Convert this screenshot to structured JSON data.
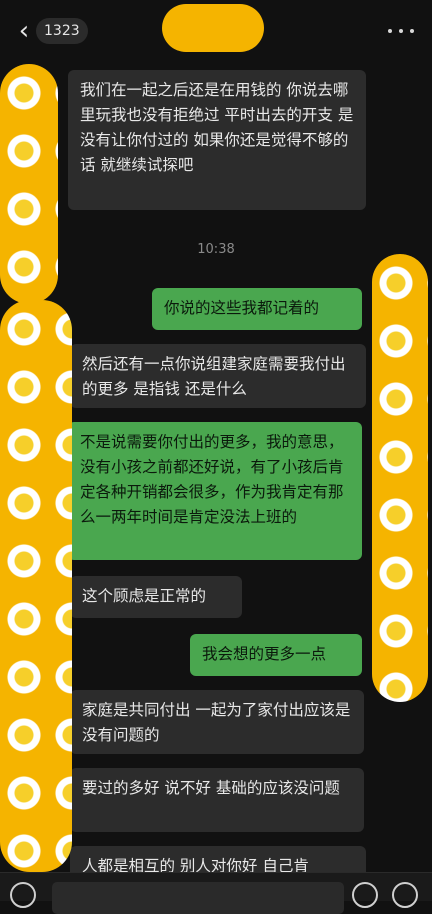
{
  "header": {
    "back_count": "1323"
  },
  "time_divider": "10:38",
  "messages": [
    {
      "side": "recv",
      "text": "我们在一起之后还是在用钱的 你说去哪里玩我也没有拒绝过 平时出去的开支 是没有让你付过的 如果你还是觉得不够的话 就继续试探吧"
    },
    {
      "side": "sent",
      "text": "你说的这些我都记着的"
    },
    {
      "side": "recv",
      "text": "然后还有一点你说组建家庭需要我付出的更多 是指钱 还是什么"
    },
    {
      "side": "sent",
      "text": "不是说需要你付出的更多，我的意思，没有小孩之前都还好说，有了小孩后肯定各种开销都会很多，作为我肯定有那么一两年时间是肯定没法上班的"
    },
    {
      "side": "recv",
      "text": "这个顾虑是正常的"
    },
    {
      "side": "sent",
      "text": "我会想的更多一点"
    },
    {
      "side": "recv",
      "text": "家庭是共同付出 一起为了家付出应该是没有问题的"
    },
    {
      "side": "recv",
      "text": "要过的多好 说不好 基础的应该没问题"
    },
    {
      "side": "recv",
      "text": "人都是相互的 别人对你好 自己肯"
    }
  ],
  "colors": {
    "background": "#111111",
    "sent_bubble": "#4aa74f",
    "recv_bubble": "#2c2c2c",
    "redaction": "#f5b400"
  }
}
